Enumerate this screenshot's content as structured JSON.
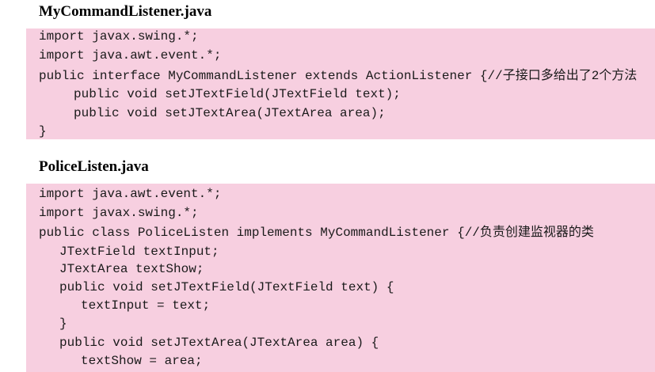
{
  "files": [
    {
      "title": "MyCommandListener.java",
      "lines": [
        "import javax.swing.*;",
        "import java.awt.event.*;",
        "public interface MyCommandListener extends ActionListener {//子接口多给出了2个方法",
        "public void setJTextField(JTextField text);",
        "public void setJTextArea(JTextArea area);",
        "}"
      ]
    },
    {
      "title": "PoliceListen.java",
      "lines": [
        "import java.awt.event.*;",
        "import javax.swing.*;",
        "public class PoliceListen implements MyCommandListener {//负责创建监视器的类",
        "JTextField textInput;",
        "JTextArea textShow;",
        "public void setJTextField(JTextField text) {",
        "textInput = text;",
        "}",
        "public void setJTextArea(JTextArea area) {",
        "textShow = area;"
      ]
    }
  ]
}
